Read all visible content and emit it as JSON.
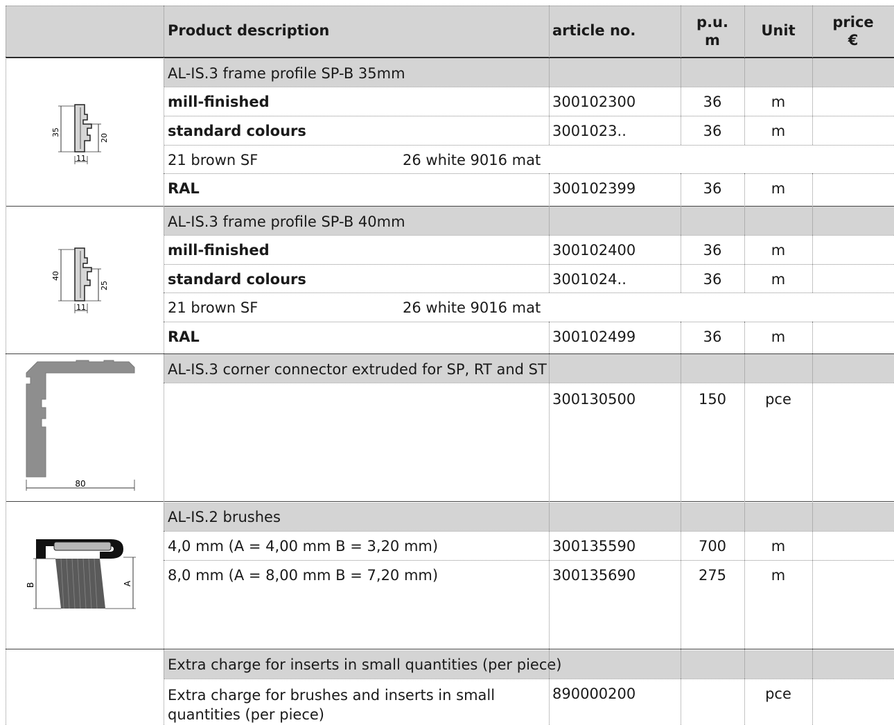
{
  "header": {
    "product_description": "Product description",
    "article_no": "article no.",
    "pu_line1": "p.u.",
    "pu_line2": "m",
    "unit": "Unit",
    "price_line1": "price",
    "price_line2": "€"
  },
  "sections": [
    {
      "title": "AL-IS.3 frame profile SP-B 35mm",
      "drawing_labels": {
        "height": "35",
        "inner": "20",
        "width": "11"
      },
      "rows": [
        {
          "desc": "mill-finished",
          "article": "300102300",
          "pu": "36",
          "unit": "m"
        },
        {
          "desc": "standard colours",
          "article": "3001023..",
          "pu": "36",
          "unit": "m"
        },
        {
          "colour1": "21 brown SF",
          "colour2": "26 white 9016 mat"
        },
        {
          "desc": "RAL",
          "article": "300102399",
          "pu": "36",
          "unit": "m"
        }
      ]
    },
    {
      "title": "AL-IS.3 frame profile SP-B 40mm",
      "drawing_labels": {
        "height": "40",
        "inner": "25",
        "width": "11"
      },
      "rows": [
        {
          "desc": "mill-finished",
          "article": "300102400",
          "pu": "36",
          "unit": "m"
        },
        {
          "desc": "standard colours",
          "article": "3001024..",
          "pu": "36",
          "unit": "m"
        },
        {
          "colour1": "21 brown SF",
          "colour2": "26 white 9016 mat"
        },
        {
          "desc": "RAL",
          "article": "300102499",
          "pu": "36",
          "unit": "m"
        }
      ]
    },
    {
      "title": "AL-IS.3 corner connector extruded for SP, RT and ST",
      "drawing_labels": {
        "width": "80"
      },
      "rows": [
        {
          "desc": "",
          "article": "300130500",
          "pu": "150",
          "unit": "pce"
        }
      ]
    },
    {
      "title": "AL-IS.2 brushes",
      "drawing_labels": {
        "b": "B",
        "a": "A"
      },
      "rows": [
        {
          "desc": "4,0 mm (A = 4,00 mm B = 3,20 mm)",
          "article": "300135590",
          "pu": "700",
          "unit": "m"
        },
        {
          "desc": "8,0 mm (A = 8,00 mm B = 7,20 mm)",
          "article": "300135690",
          "pu": "275",
          "unit": "m"
        }
      ]
    },
    {
      "title": "Extra charge for inserts in small quantities (per piece)",
      "rows": [
        {
          "desc_line1": "Extra charge for brushes and inserts in small",
          "desc_line2": "quantities (per piece)",
          "article": "890000200",
          "pu": "",
          "unit": "pce"
        }
      ]
    }
  ]
}
